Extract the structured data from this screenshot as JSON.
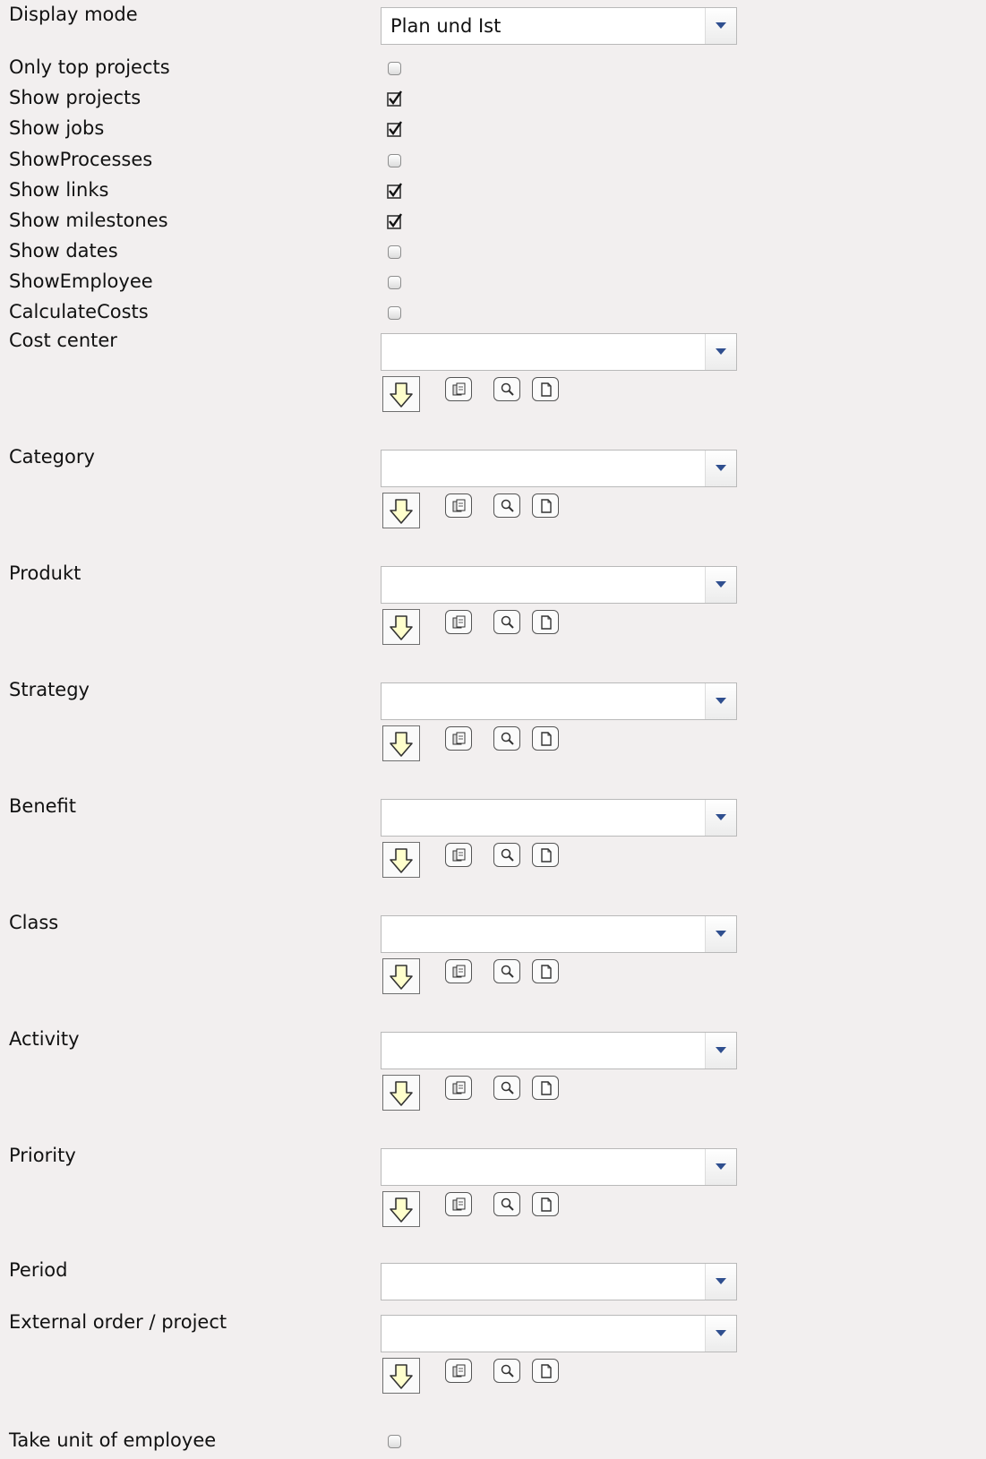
{
  "display_mode": {
    "label": "Display mode",
    "value": "Plan und Ist"
  },
  "checkboxes": [
    {
      "label": "Only top projects",
      "checked": false
    },
    {
      "label": "Show projects",
      "checked": true
    },
    {
      "label": "Show jobs",
      "checked": true
    },
    {
      "label": "ShowProcesses",
      "checked": false
    },
    {
      "label": "Show links",
      "checked": true
    },
    {
      "label": "Show milestones",
      "checked": true
    },
    {
      "label": "Show dates",
      "checked": false
    },
    {
      "label": "ShowEmployee",
      "checked": false
    },
    {
      "label": "CalculateCosts",
      "checked": false
    }
  ],
  "selects": [
    {
      "label": "Cost center",
      "value": "",
      "toolbar": true
    },
    {
      "label": "Category",
      "value": "",
      "toolbar": true
    },
    {
      "label": "Produkt",
      "value": "",
      "toolbar": true
    },
    {
      "label": "Strategy",
      "value": "",
      "toolbar": true
    },
    {
      "label": "Benefit",
      "value": "",
      "toolbar": true
    },
    {
      "label": "Class",
      "value": "",
      "toolbar": true
    },
    {
      "label": "Activity",
      "value": "",
      "toolbar": true
    },
    {
      "label": "Priority",
      "value": "",
      "toolbar": true
    },
    {
      "label": "Period",
      "value": "",
      "toolbar": false
    },
    {
      "label": "External order / project",
      "value": "",
      "toolbar": true
    }
  ],
  "take_unit": {
    "label": "Take unit of employee",
    "checked": false
  },
  "toolbar_icons": [
    "arrow-down-icon",
    "copy-icon",
    "search-icon",
    "new-document-icon"
  ],
  "colors": {
    "background": "#f2efef",
    "dropdown_arrow": "#2f4f8f",
    "down_button_fill": "#ffffcc"
  }
}
